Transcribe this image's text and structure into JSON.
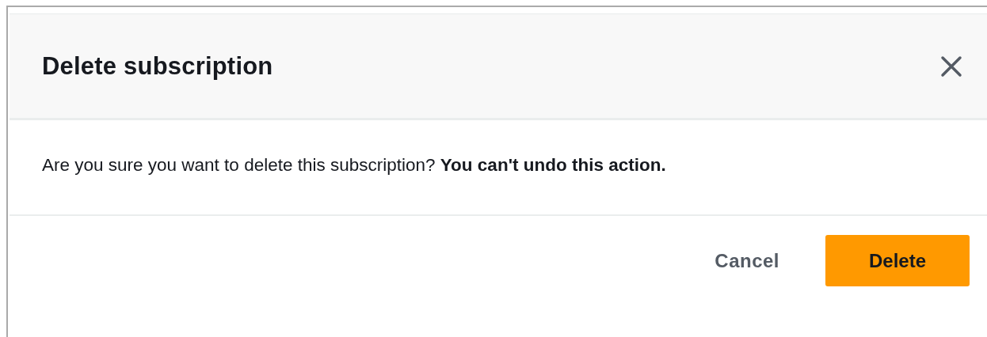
{
  "dialog": {
    "title": "Delete subscription",
    "message": "Are you sure you want to delete this subscription? **You can't undo this action.**",
    "buttons": [
      {
        "kind": "link",
        "label": "Cancel"
      },
      {
        "kind": "primary",
        "label": "Delete"
      }
    ]
  }
}
